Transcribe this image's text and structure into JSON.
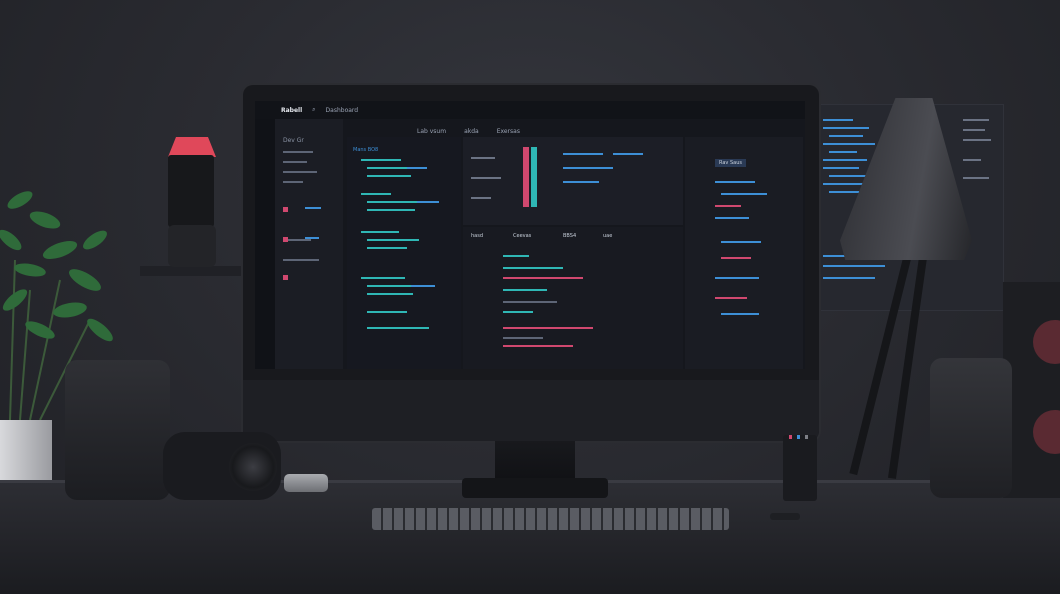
{
  "scene": {
    "subject": "monitor-with-code-editor-on-desk"
  },
  "screen": {
    "window_title": "Rabell",
    "menu": "Dashboard",
    "tabs": [
      "Lab vsum",
      "akda",
      "Exersas"
    ],
    "sidebar_label": "Dev Gr",
    "pane_titles": [
      "hasd",
      "Ceevas",
      "BBS4",
      "uae"
    ],
    "button_label": "Rav Saus",
    "editor_heading": "Mans BO8"
  },
  "colors": {
    "accent_blue": "#3d8fd6",
    "accent_teal": "#2fb7b5",
    "accent_pink": "#d0486f",
    "lamp_glow": "#e0485a"
  }
}
